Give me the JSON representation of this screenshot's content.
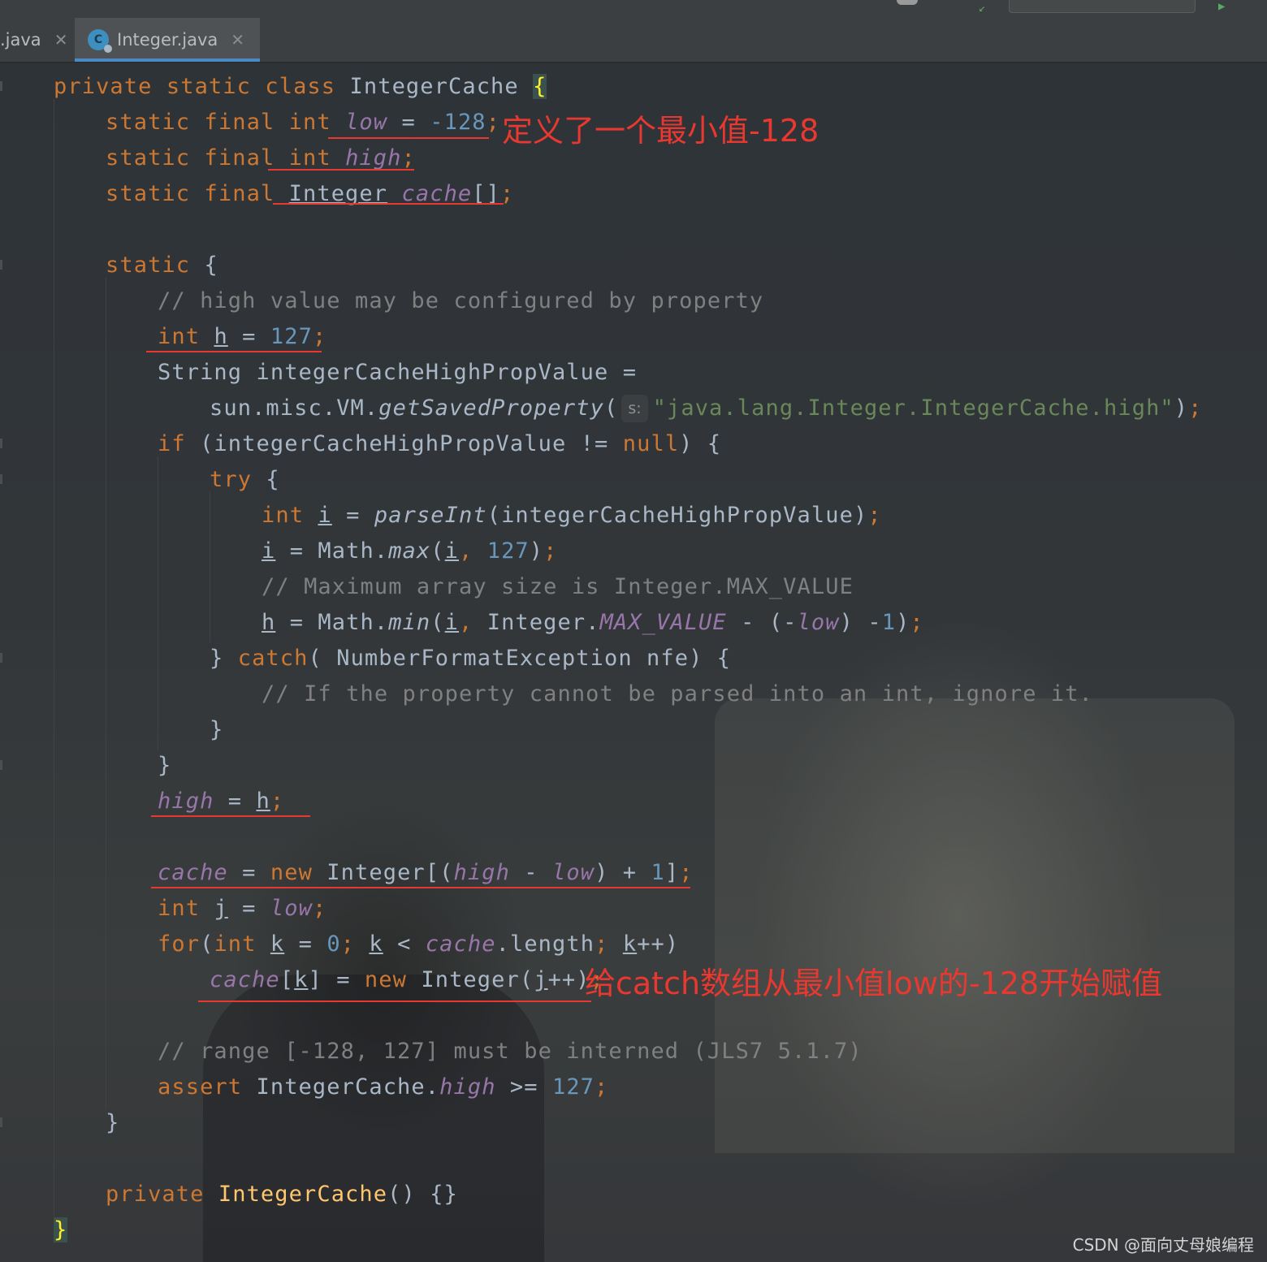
{
  "tabs": [
    {
      "label": ".java"
    },
    {
      "label": "Integer.java"
    }
  ],
  "code": {
    "l1": {
      "kw1": "private",
      "kw2": "static",
      "kw3": "class",
      "name": "IntegerCache",
      "brace": "{"
    },
    "l2": {
      "kw1": "static",
      "kw2": "final",
      "kw3": "int",
      "field": "low",
      "op": " = ",
      "num": "-128",
      "semi": ";"
    },
    "l3": {
      "kw1": "static",
      "kw2": "final",
      "kw3": "int",
      "field": "high",
      "semi": ";"
    },
    "l4": {
      "kw1": "static",
      "kw2": "final",
      "type": "Integer",
      "field": "cache",
      "rest": "[]",
      "semi": ";"
    },
    "l6": {
      "kw": "static",
      "rest": " {"
    },
    "l7": {
      "comment": "// high value may be configured by property"
    },
    "l8": {
      "kw": "int",
      "var": "h",
      "op": " = ",
      "num": "127",
      "semi": ";"
    },
    "l9": {
      "text": "String integerCacheHighPropValue ="
    },
    "l10": {
      "pre": "sun.misc.VM.",
      "method": "getSavedProperty",
      "open": "(",
      "hint": "s:",
      "str": "\"java.lang.Integer.IntegerCache.high\"",
      "close": ")",
      "semi": ";"
    },
    "l11": {
      "kw": "if",
      "mid": " (integerCacheHighPropValue != ",
      "kw2": "null",
      "end": ") {"
    },
    "l12": {
      "kw": "try",
      "rest": " {"
    },
    "l13": {
      "kw": "int",
      "var": "i",
      "op": " = ",
      "method": "parseInt",
      "rest": "(integerCacheHighPropValue)",
      "semi": ";"
    },
    "l14": {
      "var": "i",
      "mid": " = Math.",
      "method": "max",
      "open": "(",
      "var2": "i",
      "comma": ", ",
      "num": "127",
      "close": ")",
      "semi": ";"
    },
    "l15": {
      "comment": "// Maximum array size is Integer.MAX_VALUE"
    },
    "l16": {
      "var": "h",
      "mid": " = Math.",
      "method": "min",
      "open": "(",
      "var2": "i",
      "comma": ", ",
      "mid2": "Integer.",
      "field": "MAX_VALUE",
      "op": " - (-",
      "field2": "low",
      "op2": ") -",
      "num": "1",
      "close": ")",
      "semi": ";"
    },
    "l17": {
      "pre": "} ",
      "kw": "catch",
      "rest": "( NumberFormatException nfe) {"
    },
    "l18": {
      "comment": "// If the property cannot be parsed into an int, ignore it."
    },
    "l19": {
      "text": "}"
    },
    "l20": {
      "text": "}"
    },
    "l21": {
      "field": "high",
      "op": " = ",
      "var": "h",
      "semi": ";"
    },
    "l23": {
      "field": "cache",
      "op": " = ",
      "kw": "new",
      "mid": " Integer[(",
      "field2": "high",
      "op2": " - ",
      "field3": "low",
      "mid2": ") + ",
      "num": "1",
      "close": "]",
      "semi": ";"
    },
    "l24": {
      "kw": "int",
      "var": "j",
      "op": " = ",
      "field": "low",
      "semi": ";"
    },
    "l25": {
      "kw": "for",
      "open": "(",
      "kw2": "int",
      "var": "k",
      "op": " = ",
      "num": "0",
      "semi1": "; ",
      "var2": "k",
      "op2": " < ",
      "field": "cache",
      "mid": ".length",
      "semi2": "; ",
      "var3": "k",
      "end": "++)"
    },
    "l26": {
      "field": "cache",
      "open": "[",
      "var": "k",
      "mid": "] = ",
      "kw": "new",
      "rest": " Integer(",
      "var2": "j",
      "end": "++)",
      "semi": ";"
    },
    "l28": {
      "comment": "// range [-128, 127] must be interned (JLS7 5.1.7)"
    },
    "l29": {
      "kw": "assert",
      "mid": " IntegerCache.",
      "field": "high",
      "op": " >= ",
      "num": "127",
      "semi": ";"
    },
    "l30": {
      "text": "}"
    },
    "l32": {
      "kw": "private",
      "name": "IntegerCache",
      "rest": "() {}"
    },
    "l33": {
      "brace": "}"
    }
  },
  "annotations": {
    "a1": "定义了一个最小值-128",
    "a2": "给catch数组从最小值low的-128开始赋值"
  },
  "watermark": "CSDN @面向丈母娘编程",
  "colors": {
    "keyword": "#cc7832",
    "number": "#6897bb",
    "string": "#6a8759",
    "comment": "#808080",
    "field": "#9876aa",
    "annotation": "#e8382f"
  }
}
